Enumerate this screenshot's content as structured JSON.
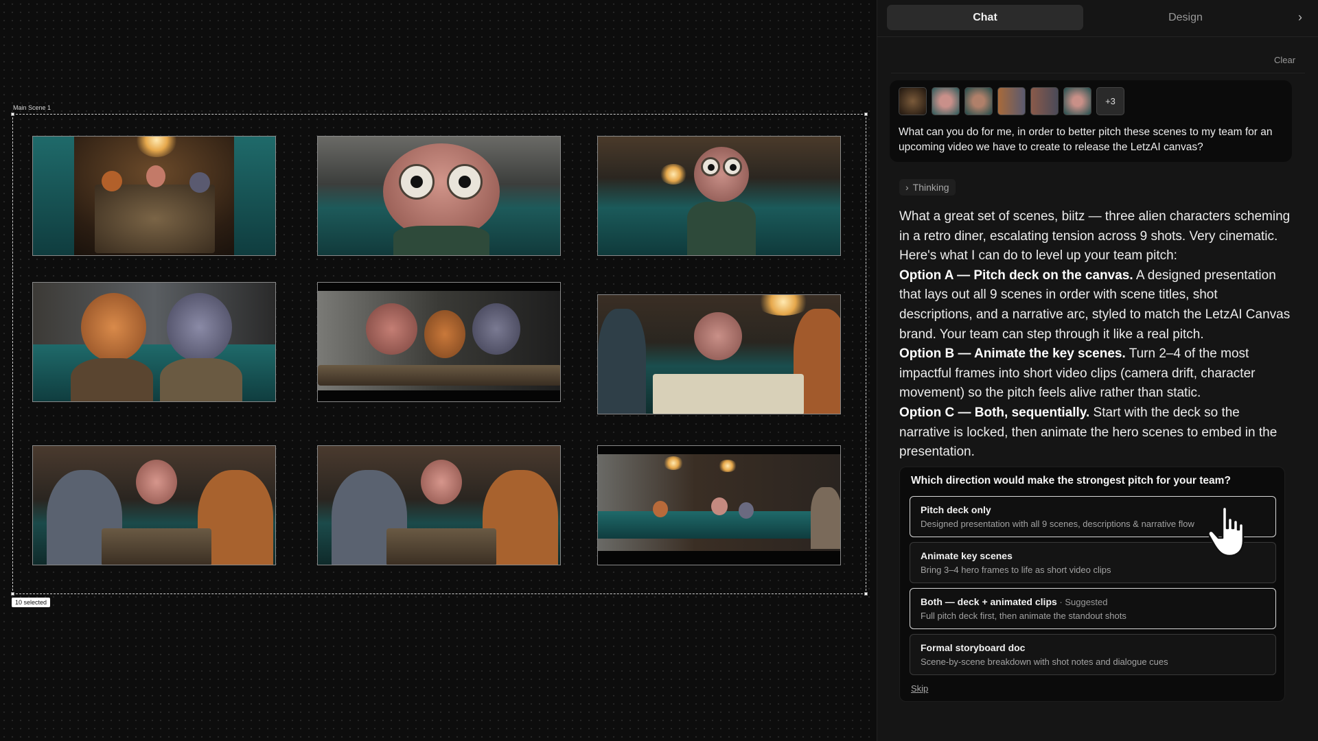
{
  "canvas": {
    "frame_label": "Main Scene 1",
    "selected_badge": "10 selected",
    "scenes": [
      {
        "name": "scene-1"
      },
      {
        "name": "scene-2"
      },
      {
        "name": "scene-3"
      },
      {
        "name": "scene-4"
      },
      {
        "name": "scene-5"
      },
      {
        "name": "scene-6"
      },
      {
        "name": "scene-7"
      },
      {
        "name": "scene-8"
      },
      {
        "name": "scene-9"
      }
    ]
  },
  "panel": {
    "tabs": [
      {
        "label": "Chat",
        "active": true
      },
      {
        "label": "Design",
        "active": false
      }
    ],
    "collapse_icon": "chevron-right-icon",
    "clear_label": "Clear",
    "user_message": {
      "attachments_more": "+3",
      "text": "What can you do for me, in order to better pitch these scenes to my team for an upcoming video we have to create to release the LetzAI canvas?"
    },
    "thinking_label": "Thinking",
    "reply": {
      "intro": "What a great set of scenes, biitz — three alien characters scheming in a retro diner, escalating tension across 9 shots. Very cinematic. Here's what I can do to level up your team pitch:",
      "option_a_title": "Option A — Pitch deck on the canvas.",
      "option_a_text": " A designed presentation that lays out all 9 scenes in order with scene titles, shot descriptions, and a narrative arc, styled to match the LetzAI Canvas brand. Your team can step through it like a real pitch.",
      "option_b_title": "Option B — Animate the key scenes.",
      "option_b_text": " Turn 2–4 of the most impactful frames into short video clips (camera drift, character movement) so the pitch feels alive rather than static.",
      "option_c_title": "Option C — Both, sequentially.",
      "option_c_text": " Start with the deck so the narrative is locked, then animate the hero scenes to embed in the presentation."
    },
    "question": {
      "title": "Which direction would make the strongest pitch for your team?",
      "options": [
        {
          "title": "Pitch deck only",
          "tag": "",
          "desc": "Designed presentation with all 9 scenes, descriptions & narrative flow"
        },
        {
          "title": "Animate key scenes",
          "tag": "",
          "desc": "Bring 3–4 hero frames to life as short video clips"
        },
        {
          "title": "Both — deck + animated clips",
          "tag": " · Suggested",
          "desc": "Full pitch deck first, then animate the standout shots"
        },
        {
          "title": "Formal storyboard doc",
          "tag": "",
          "desc": "Scene-by-scene breakdown with shot notes and dialogue cues"
        }
      ],
      "skip_label": "Skip"
    }
  },
  "colors": {
    "canvas_bg": "#0d0d0d",
    "panel_bg": "#151515",
    "booth_teal": "#1f6a6a",
    "warm_light": "#e6a84c"
  }
}
